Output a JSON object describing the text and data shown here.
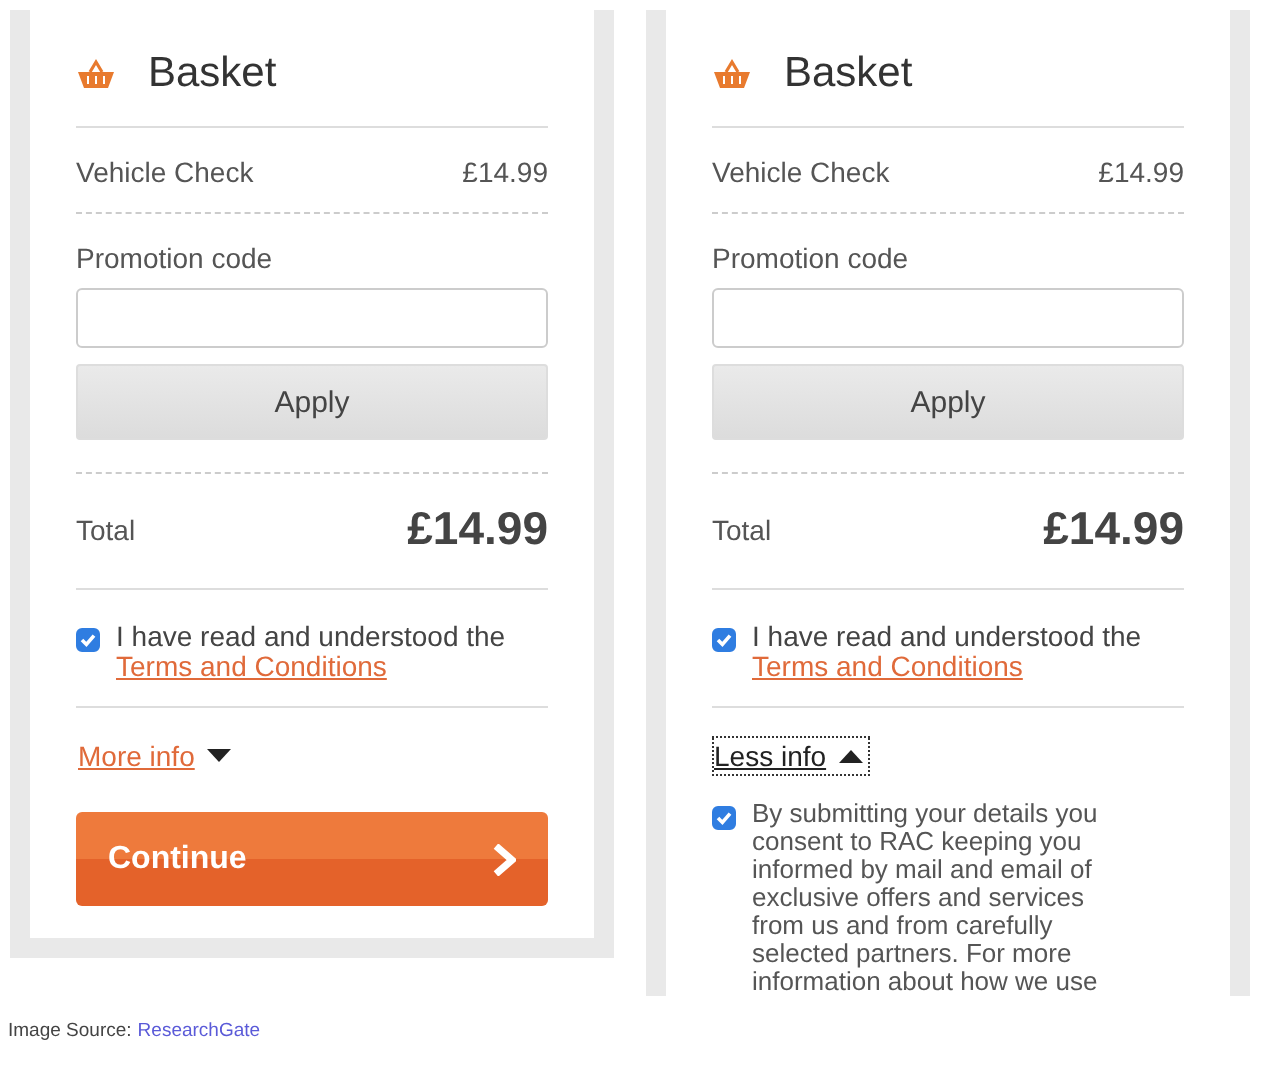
{
  "panels": [
    {
      "title": "Basket",
      "item": {
        "name": "Vehicle Check",
        "price": "£14.99"
      },
      "promo": {
        "label": "Promotion code",
        "button": "Apply"
      },
      "total": {
        "label": "Total",
        "value": "£14.99"
      },
      "terms": {
        "checked": true,
        "text": "I have read and understood the",
        "link": "Terms and Conditions"
      },
      "toggle": {
        "label": "More info",
        "expanded": false
      },
      "continue": "Continue"
    },
    {
      "title": "Basket",
      "item": {
        "name": "Vehicle Check",
        "price": "£14.99"
      },
      "promo": {
        "label": "Promotion code",
        "button": "Apply"
      },
      "total": {
        "label": "Total",
        "value": "£14.99"
      },
      "terms": {
        "checked": true,
        "text": "I have read and understood the",
        "link": "Terms and Conditions"
      },
      "toggle": {
        "label": "Less info",
        "expanded": true
      },
      "consent": {
        "checked": true,
        "text": "By submitting your details you consent to RAC keeping you informed by mail and email of exclusive offers and services from us and from carefully selected partners. For more information about how we use"
      }
    }
  ],
  "caption": {
    "label": "Image Source:",
    "link": "ResearchGate"
  }
}
